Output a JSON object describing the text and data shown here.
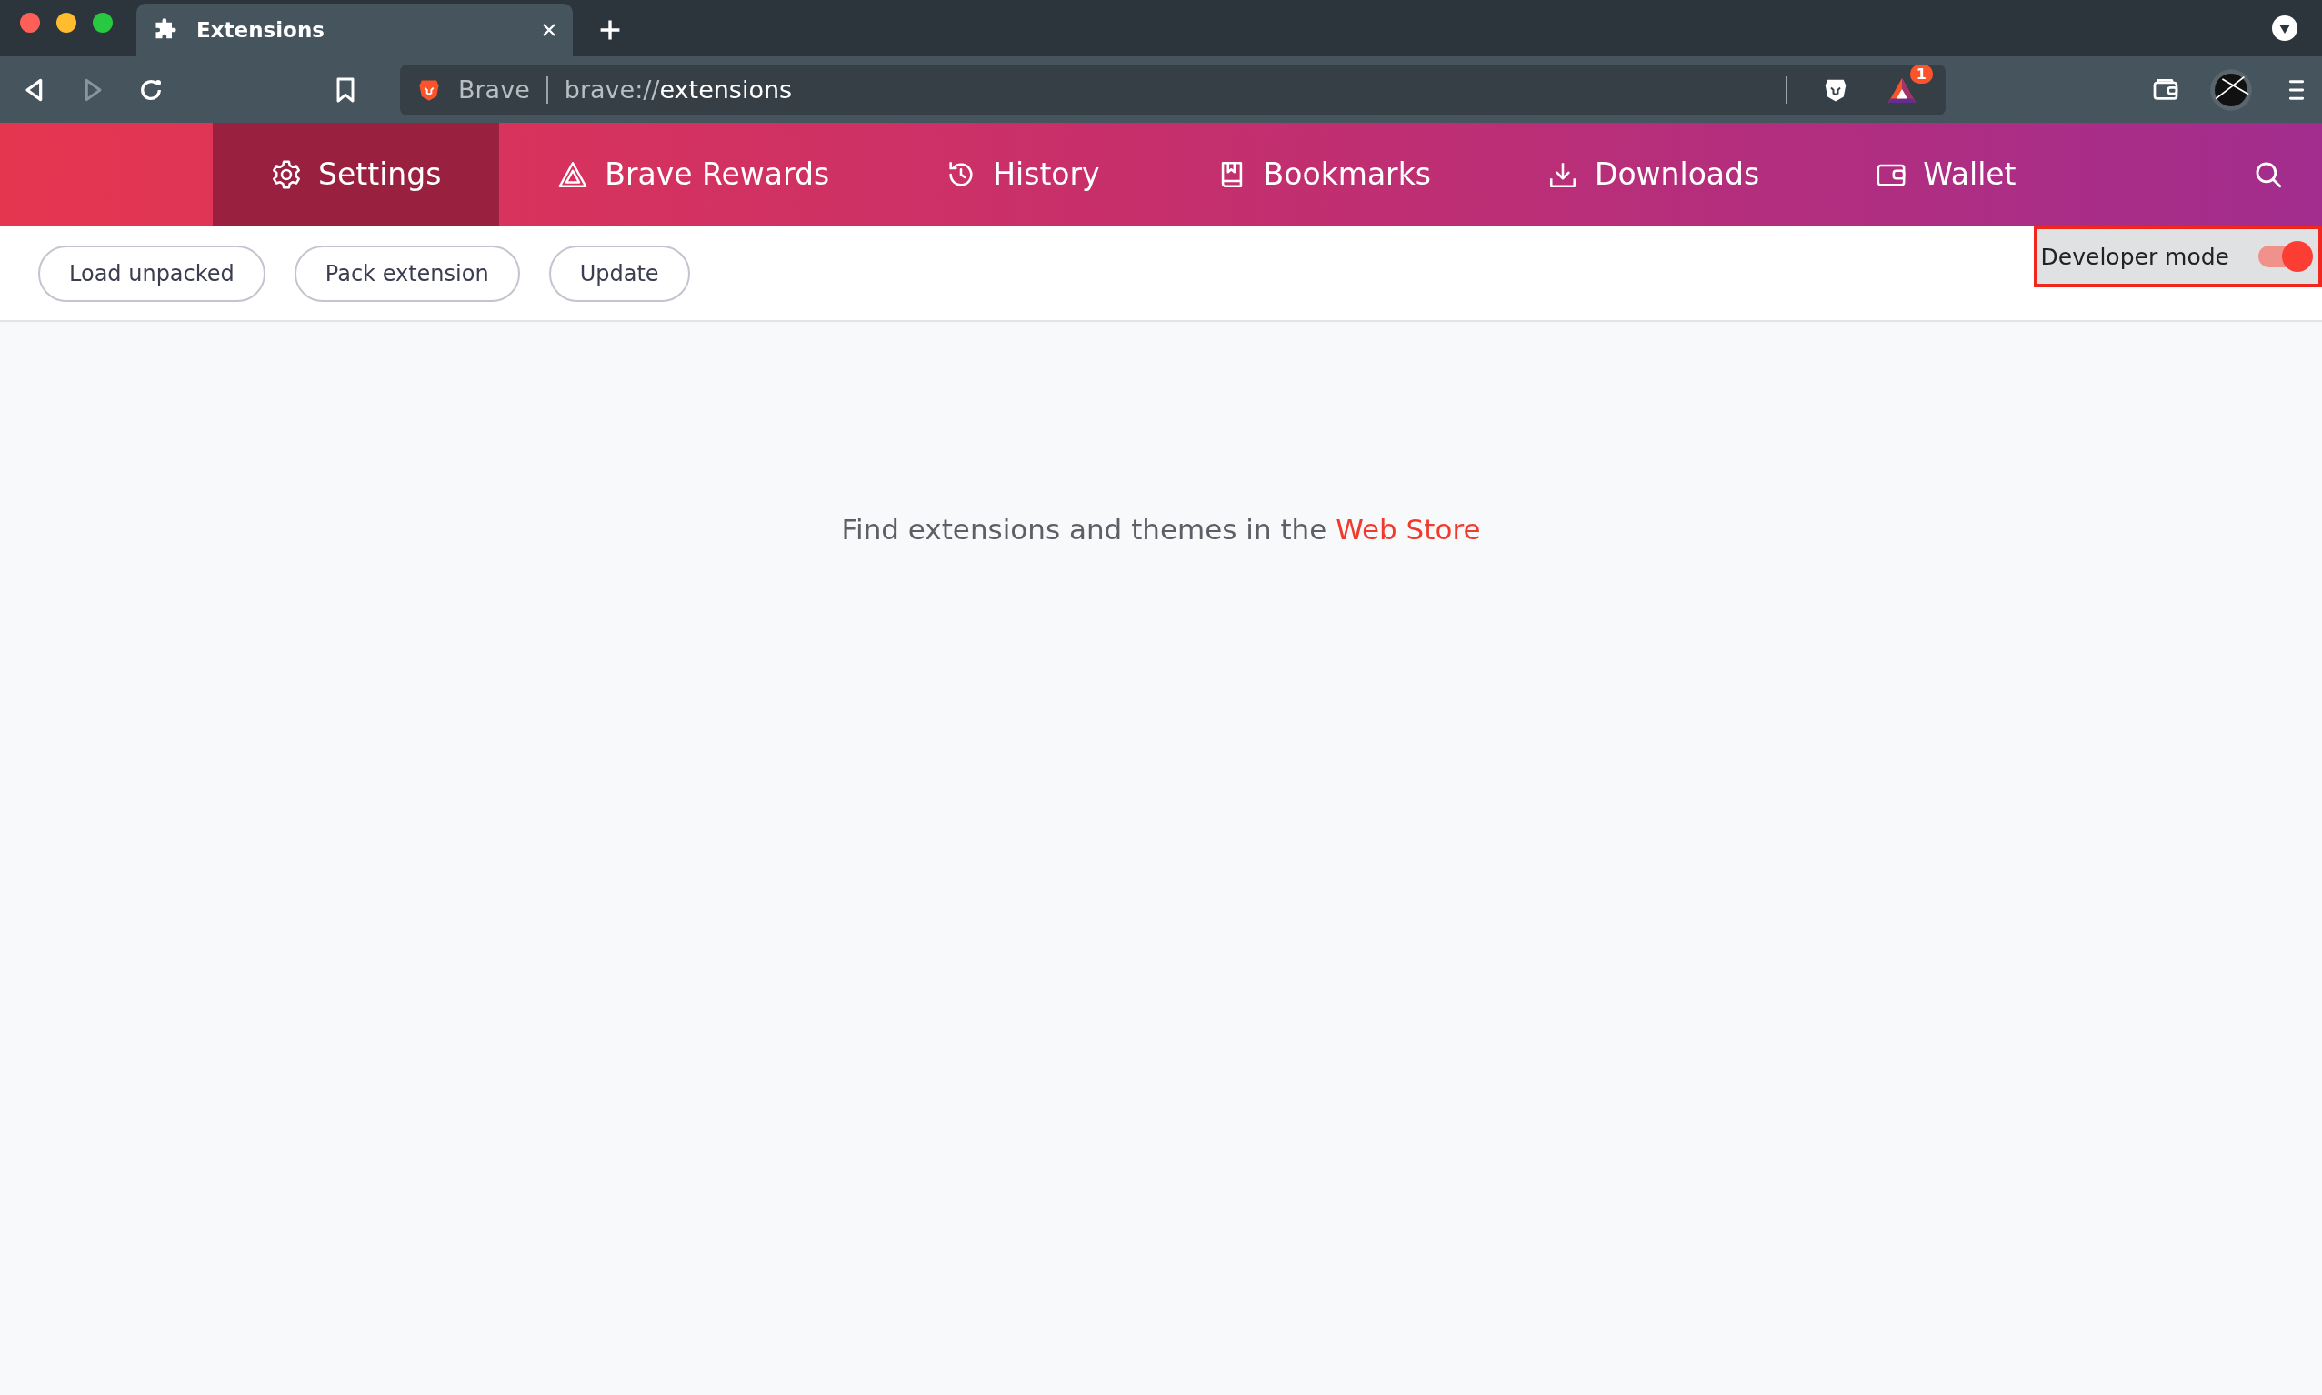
{
  "window": {
    "title": "Extensions"
  },
  "address_bar": {
    "site_label": "Brave",
    "url_scheme": "brave://",
    "url_path": "extensions"
  },
  "rewards_badge": "1",
  "nav": [
    {
      "label": "Settings",
      "kind": "gear",
      "selected": true
    },
    {
      "label": "Brave Rewards",
      "kind": "triangle",
      "selected": false
    },
    {
      "label": "History",
      "kind": "history",
      "selected": false
    },
    {
      "label": "Bookmarks",
      "kind": "bookmark",
      "selected": false
    },
    {
      "label": "Downloads",
      "kind": "download",
      "selected": false
    },
    {
      "label": "Wallet",
      "kind": "wallet",
      "selected": false
    }
  ],
  "toolbar_buttons": [
    "Load unpacked",
    "Pack extension",
    "Update"
  ],
  "developer_mode": {
    "label": "Developer mode",
    "on": true,
    "highlighted": true
  },
  "message": {
    "text": "Find extensions and themes in the",
    "link": "Web Store"
  }
}
